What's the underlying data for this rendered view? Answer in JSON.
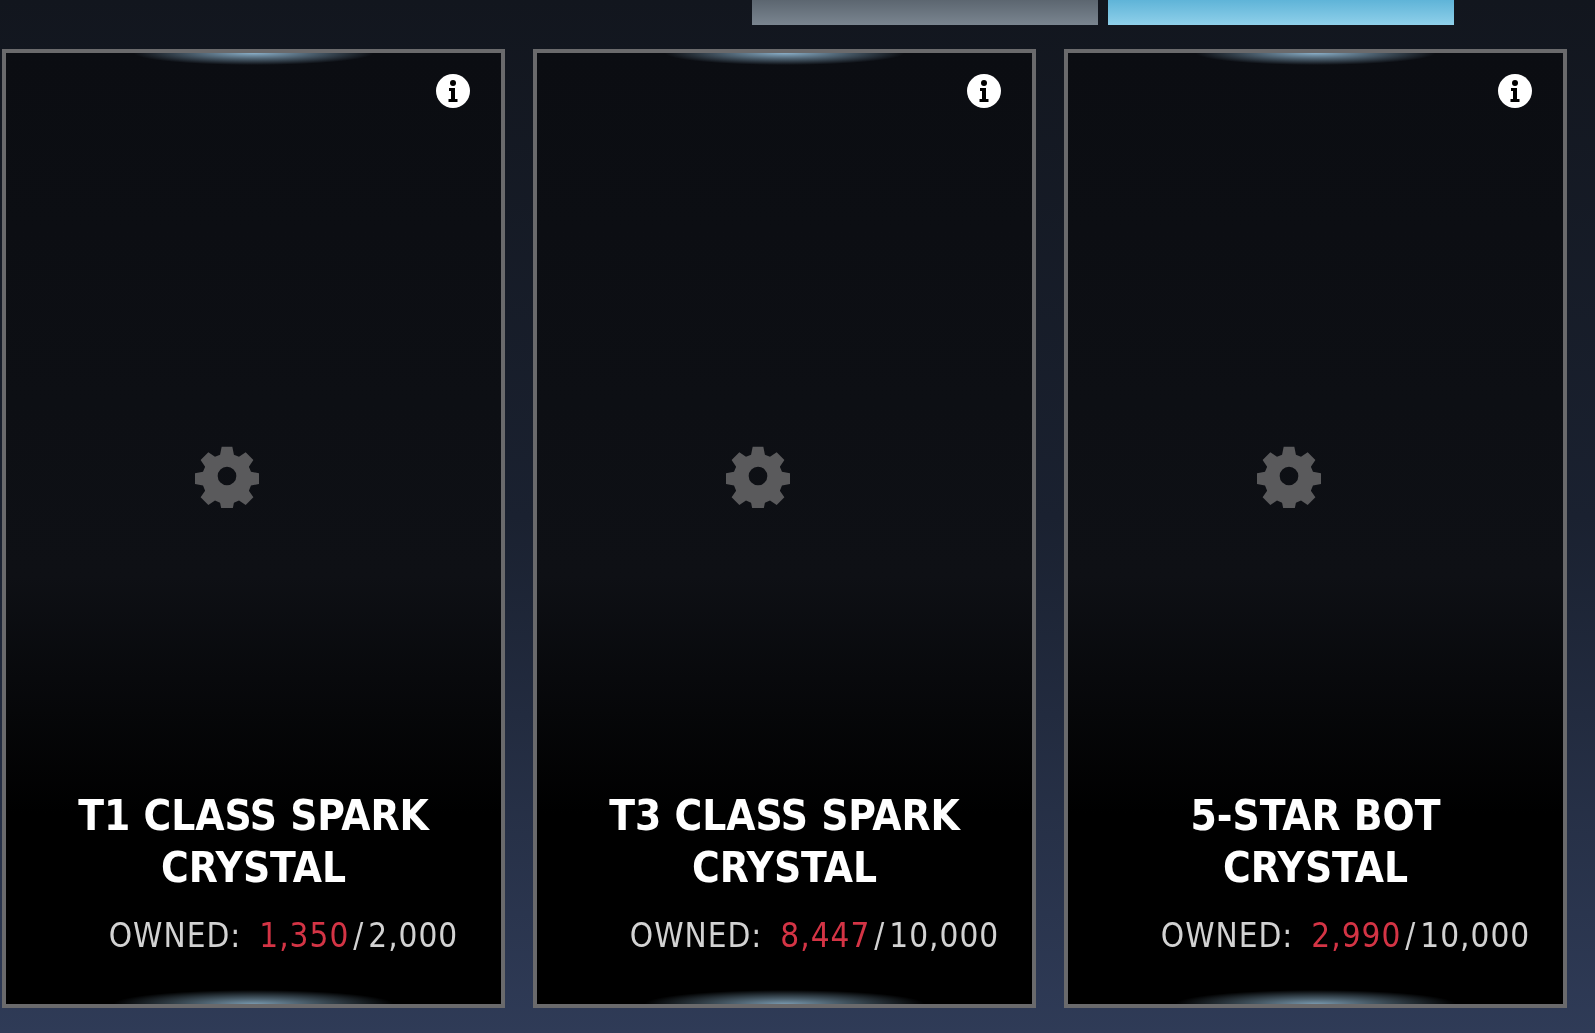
{
  "tabs": [
    {
      "selected": false
    },
    {
      "selected": true
    }
  ],
  "cards": [
    {
      "title": "T1 CLASS SPARK CRYSTAL",
      "owned_label": "OWNED:",
      "owned": "1,350",
      "separator": "/",
      "total": "2,000"
    },
    {
      "title": "T3 CLASS SPARK CRYSTAL",
      "owned_label": "OWNED:",
      "owned": "8,447",
      "separator": "/",
      "total": "10,000"
    },
    {
      "title": "5-STAR BOT CRYSTAL",
      "owned_label": "OWNED:",
      "owned": "2,990",
      "separator": "/",
      "total": "10,000"
    }
  ]
}
